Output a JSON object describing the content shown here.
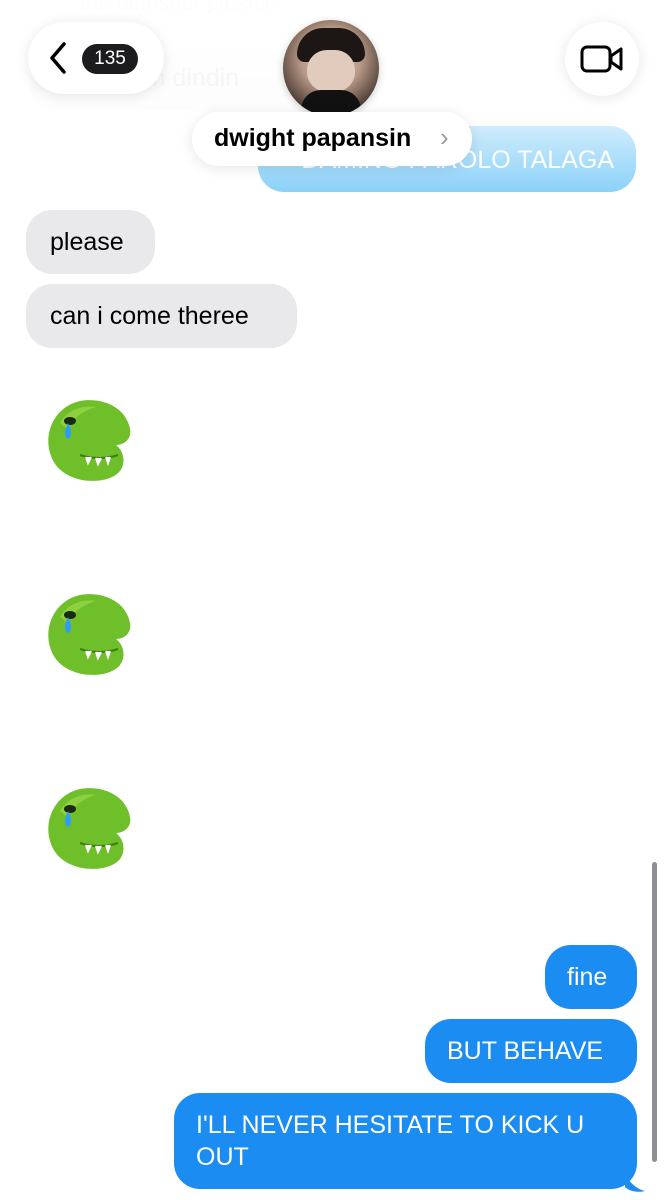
{
  "header": {
    "back_count": "135",
    "contact_name": "dwight papansin",
    "contact_chevron": "›"
  },
  "faded_messages": {
    "line1": "the dinosaur plushie",
    "line2": "dadalhim dindin",
    "header_bubble": "DAMING PAROLO TALAGA"
  },
  "messages": {
    "recv1": "please",
    "recv2": "can i come theree",
    "sent1": "fine",
    "sent2": "BUT BEHAVE",
    "sent3": "I'LL NEVER HESITATE TO KICK U OUT"
  },
  "stickers": [
    "crying-dinosaur-sticker",
    "crying-dinosaur-sticker",
    "crying-dinosaur-sticker"
  ],
  "colors": {
    "sent_bubble": "#1b8cf2",
    "received_bubble": "#e9e9eb",
    "dino_green": "#6fbf2a"
  }
}
